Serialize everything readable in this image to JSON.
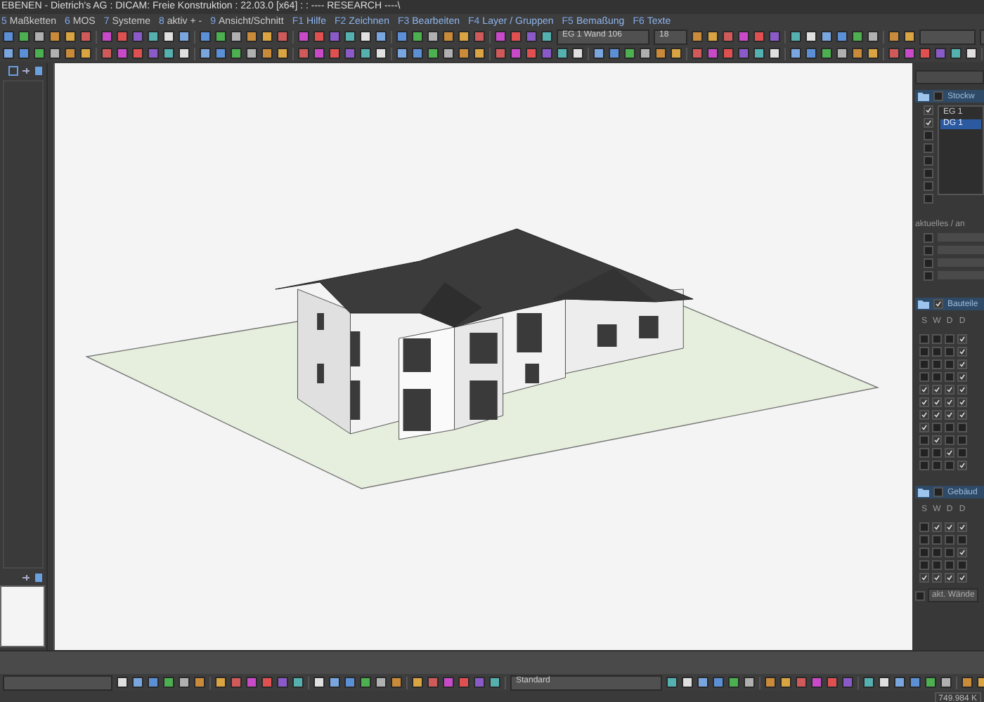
{
  "window": {
    "title": "EBENEN - Dietrich's AG : DICAM: Freie Konstruktion : 22.03.0 [x64] : : ---- RESEARCH ----\\"
  },
  "menu": [
    {
      "key": "5",
      "label": "Maßketten"
    },
    {
      "key": "6",
      "label": "MOS"
    },
    {
      "key": "7",
      "label": "Systeme"
    },
    {
      "key": "8",
      "label": "aktiv + -"
    },
    {
      "key": "9",
      "label": "Ansicht/Schnitt"
    },
    {
      "key": "F1",
      "label": "Hilfe"
    },
    {
      "key": "F2",
      "label": "Zeichnen"
    },
    {
      "key": "F3",
      "label": "Bearbeiten"
    },
    {
      "key": "F4",
      "label": "Layer / Gruppen"
    },
    {
      "key": "F5",
      "label": "Bemaßung"
    },
    {
      "key": "F6",
      "label": "Texte"
    }
  ],
  "toolbar": {
    "wall_select": "EG 1 Wand 106",
    "scale": "18"
  },
  "right_panel": {
    "floors": {
      "title": "Stockw",
      "checked": false,
      "items": [
        {
          "label": "EG 1",
          "checked": true,
          "selected": false
        },
        {
          "label": "DG 1",
          "checked": true,
          "selected": true
        },
        {
          "checked": false
        },
        {
          "checked": false
        },
        {
          "checked": false
        },
        {
          "checked": false
        },
        {
          "checked": false
        },
        {
          "checked": false
        }
      ]
    },
    "current_label": "aktuelles / an",
    "current_rows": [
      {
        "checked": false
      },
      {
        "checked": false
      },
      {
        "checked": false
      },
      {
        "checked": false
      }
    ],
    "footer_checked": false,
    "components": {
      "title": "Bauteile",
      "checked": true,
      "columns": [
        "S",
        "W",
        "D",
        "D"
      ],
      "rows": [
        {
          "checked": [
            false,
            false,
            false,
            true
          ]
        },
        {
          "checked": [
            false,
            false,
            false,
            true
          ]
        },
        {
          "checked": [
            false,
            false,
            false,
            true
          ]
        },
        {
          "checked": [
            false,
            false,
            false,
            true
          ]
        },
        {
          "checked": [
            true,
            true,
            true,
            true
          ]
        },
        {
          "checked": [
            true,
            true,
            true,
            true
          ]
        },
        {
          "checked": [
            true,
            true,
            true,
            true
          ]
        },
        {
          "checked": [
            true,
            false,
            false,
            false
          ]
        },
        {
          "checked": [
            false,
            true,
            false,
            false
          ]
        },
        {
          "checked": [
            false,
            false,
            true,
            false
          ]
        },
        {
          "checked": [
            false,
            false,
            false,
            true
          ]
        }
      ]
    },
    "buildings": {
      "title": "Gebäud",
      "checked": false,
      "columns": [
        "S",
        "W",
        "D",
        "D"
      ],
      "rows": [
        {
          "checked": [
            false,
            true,
            true,
            true
          ]
        },
        {
          "checked": [
            false,
            false,
            false,
            false
          ]
        },
        {
          "checked": [
            false,
            false,
            false,
            true
          ]
        },
        {
          "checked": [
            false,
            false,
            false,
            false
          ]
        },
        {
          "checked": [
            true,
            true,
            true,
            true
          ]
        }
      ]
    },
    "footer_label": "akt. Wände"
  },
  "bottom_toolbar": {
    "style_select": "Standard"
  },
  "status_bar": {
    "value": "749.984 K"
  }
}
